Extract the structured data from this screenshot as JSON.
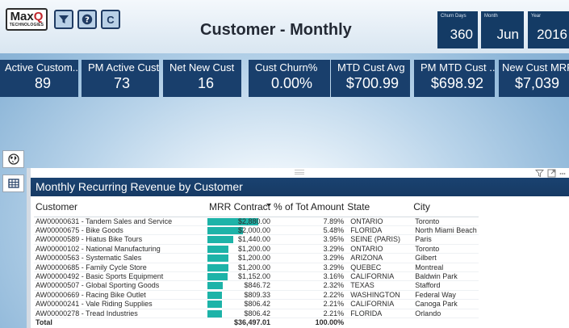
{
  "header": {
    "logo_text_main_left": "Max",
    "logo_text_main_right": "Q",
    "logo_text_sub": "TECHNOLOGIES",
    "title": "Customer - Monthly",
    "buttons": [
      {
        "name": "filter-icon"
      },
      {
        "name": "help-icon"
      },
      {
        "name": "refresh-icon"
      }
    ],
    "churn_days": {
      "label": "Churn Days",
      "value": "360"
    },
    "month": {
      "label": "Month",
      "value": "Jun"
    },
    "year": {
      "label": "Year",
      "value": "2016"
    }
  },
  "kpis": [
    {
      "label": "Active Custom...",
      "value": "89"
    },
    {
      "label": "PM Active Cust",
      "value": "73"
    },
    {
      "label": "Net New Cust",
      "value": "16"
    },
    {
      "label": "Cust Churn%",
      "value": "0.00%"
    },
    {
      "label": "MTD Cust Avg",
      "value": "$700.99"
    },
    {
      "label": "PM MTD Cust ...",
      "value": "$698.92"
    },
    {
      "label": "New Cust MRR",
      "value": "$7,039"
    }
  ],
  "side_buttons": [
    {
      "name": "globe-icon"
    },
    {
      "name": "table-icon"
    }
  ],
  "panel": {
    "title": "Monthly Recurring Revenue by Customer",
    "columns": [
      "Customer",
      "MRR Contract",
      "% of Tot Amount",
      "State",
      "City"
    ],
    "max_mrr": 2880,
    "rows": [
      {
        "customer": "AW00000631 - Tandem Sales and Service",
        "mrr": "$2,880.00",
        "mrr_num": 2880,
        "pct": "7.89%",
        "state": "ONTARIO",
        "city": "Toronto"
      },
      {
        "customer": "AW00000675 - Bike Goods",
        "mrr": "$2,000.00",
        "mrr_num": 2000,
        "pct": "5.48%",
        "state": "FLORIDA",
        "city": "North Miami Beach"
      },
      {
        "customer": "AW00000589 - Hiatus Bike Tours",
        "mrr": "$1,440.00",
        "mrr_num": 1440,
        "pct": "3.95%",
        "state": "SEINE (PARIS)",
        "city": "Paris"
      },
      {
        "customer": "AW00000102 - National Manufacturing",
        "mrr": "$1,200.00",
        "mrr_num": 1200,
        "pct": "3.29%",
        "state": "ONTARIO",
        "city": "Toronto"
      },
      {
        "customer": "AW00000563 - Systematic Sales",
        "mrr": "$1,200.00",
        "mrr_num": 1200,
        "pct": "3.29%",
        "state": "ARIZONA",
        "city": "Gilbert"
      },
      {
        "customer": "AW00000685 - Family Cycle Store",
        "mrr": "$1,200.00",
        "mrr_num": 1200,
        "pct": "3.29%",
        "state": "QUEBEC",
        "city": "Montreal"
      },
      {
        "customer": "AW00000492 - Basic Sports Equipment",
        "mrr": "$1,152.00",
        "mrr_num": 1152,
        "pct": "3.16%",
        "state": "CALIFORNIA",
        "city": "Baldwin Park"
      },
      {
        "customer": "AW00000507 - Global Sporting Goods",
        "mrr": "$846.72",
        "mrr_num": 846.72,
        "pct": "2.32%",
        "state": "TEXAS",
        "city": "Stafford"
      },
      {
        "customer": "AW00000669 - Racing Bike Outlet",
        "mrr": "$809.33",
        "mrr_num": 809.33,
        "pct": "2.22%",
        "state": "WASHINGTON",
        "city": "Federal Way"
      },
      {
        "customer": "AW00000241 - Vale Riding Supplies",
        "mrr": "$806.42",
        "mrr_num": 806.42,
        "pct": "2.21%",
        "state": "CALIFORNIA",
        "city": "Canoga Park"
      },
      {
        "customer": "AW00000278 - Tread Industries",
        "mrr": "$806.42",
        "mrr_num": 806.42,
        "pct": "2.21%",
        "state": "FLORIDA",
        "city": "Orlando"
      }
    ],
    "total": {
      "customer": "Total",
      "mrr": "$36,497.01",
      "pct": "100.00%"
    }
  },
  "colors": {
    "tile": "#193f6c",
    "bar": "#1db3a8",
    "accent_red": "#c0272d"
  }
}
